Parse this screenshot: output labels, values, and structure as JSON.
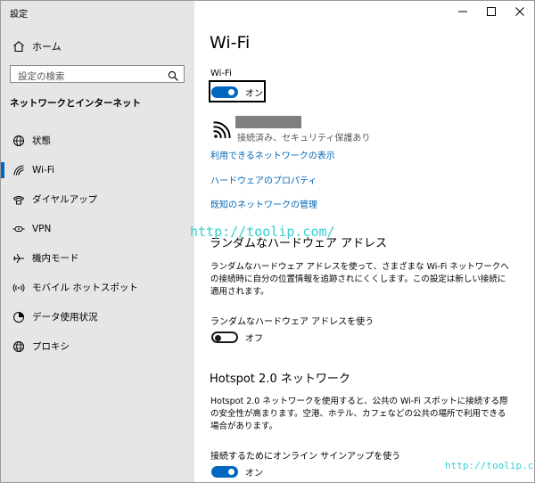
{
  "window": {
    "title": "設定"
  },
  "sidebar": {
    "home": "ホーム",
    "search_placeholder": "設定の検索",
    "section": "ネットワークとインターネット",
    "items": [
      {
        "label": "状態",
        "icon": "globe-icon"
      },
      {
        "label": "Wi-Fi",
        "icon": "wifi-icon",
        "active": true
      },
      {
        "label": "ダイヤルアップ",
        "icon": "phone-icon"
      },
      {
        "label": "VPN",
        "icon": "vpn-icon"
      },
      {
        "label": "機内モード",
        "icon": "airplane-icon"
      },
      {
        "label": "モバイル ホットスポット",
        "icon": "hotspot-icon"
      },
      {
        "label": "データ使用状況",
        "icon": "data-usage-icon"
      },
      {
        "label": "プロキシ",
        "icon": "proxy-globe-icon"
      }
    ]
  },
  "main": {
    "title": "Wi-Fi",
    "wifi_label": "Wi-Fi",
    "wifi_state": "オン",
    "network_status": "接続済み、セキュリティ保護あり",
    "links": {
      "available": "利用できるネットワークの表示",
      "hardware": "ハードウェアのプロパティ",
      "known": "既知のネットワークの管理"
    },
    "random": {
      "heading": "ランダムなハードウェア アドレス",
      "description": "ランダムなハードウェア アドレスを使って、さまざまな Wi-Fi ネットワークへの接続時に自分の位置情報を追跡されにくくします。この設定は新しい接続に適用されます。",
      "toggle_label": "ランダムなハードウェア アドレスを使う",
      "toggle_state": "オフ"
    },
    "hotspot": {
      "heading": "Hotspot 2.0 ネットワーク",
      "description": "Hotspot 2.0 ネットワークを使用すると、公共の Wi-Fi スポットに接続する際の安全性が高まります。空港、ホテル、カフェなどの公共の場所で利用できる場合があります。",
      "toggle_label": "接続するためにオンライン サインアップを使う",
      "toggle_state": "オン"
    }
  },
  "watermark": {
    "text": "http://toolip.com/",
    "color": "#37d0d0"
  }
}
